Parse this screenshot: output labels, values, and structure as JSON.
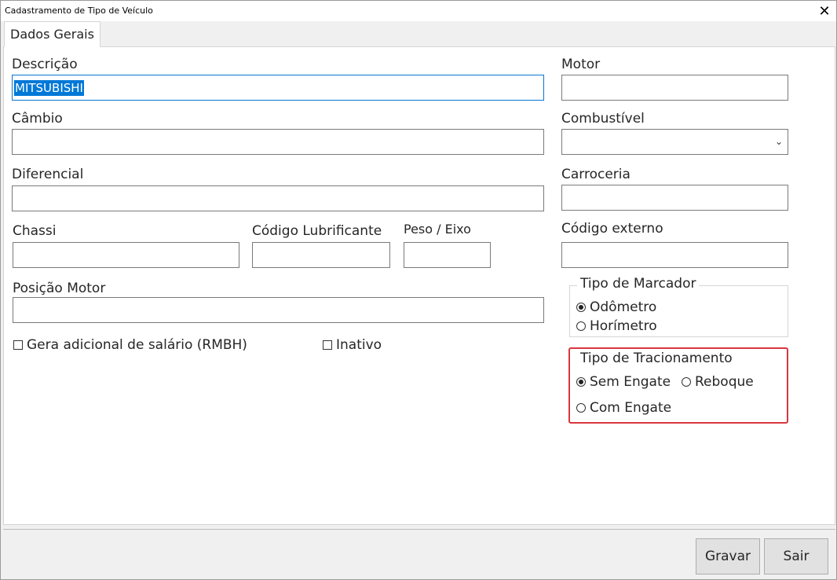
{
  "window": {
    "title": "Cadastramento de Tipo de Veículo",
    "close_glyph": "✕"
  },
  "tabs": [
    {
      "label": "Dados Gerais"
    }
  ],
  "form": {
    "descricao": {
      "label": "Descrição",
      "value": "MITSUBISHI"
    },
    "cambio": {
      "label": "Câmbio",
      "value": ""
    },
    "diferencial": {
      "label": "Diferencial",
      "value": ""
    },
    "chassi": {
      "label": "Chassi",
      "value": ""
    },
    "codigo_lubrificante": {
      "label": "Código Lubrificante",
      "value": ""
    },
    "peso_eixo": {
      "label": "Peso / Eixo",
      "value": ""
    },
    "posicao_motor": {
      "label": "Posição Motor",
      "value": ""
    },
    "motor": {
      "label": "Motor",
      "value": ""
    },
    "combustivel": {
      "label": "Combustível",
      "value": "",
      "arrow": "⌄"
    },
    "carroceria": {
      "label": "Carroceria",
      "value": ""
    },
    "codigo_externo": {
      "label": "Código externo",
      "value": ""
    },
    "gera_adicional": {
      "label": "Gera adicional de salário (RMBH)",
      "checked": false
    },
    "inativo": {
      "label": "Inativo",
      "checked": false
    }
  },
  "tipo_marcador": {
    "legend": "Tipo de Marcador",
    "options": [
      {
        "label": "Odômetro",
        "selected": true
      },
      {
        "label": "Horímetro",
        "selected": false
      }
    ]
  },
  "tipo_tracionamento": {
    "legend": "Tipo de Tracionamento",
    "options": [
      {
        "label": "Sem Engate",
        "selected": true
      },
      {
        "label": "Reboque",
        "selected": false
      },
      {
        "label": "Com Engate",
        "selected": false
      }
    ],
    "highlight_color": "#d9363e"
  },
  "buttons": {
    "gravar": "Gravar",
    "sair": "Sair"
  },
  "colors": {
    "selection": "#0078d7",
    "focus_border": "#0a74d4"
  },
  "icons": {
    "close": "close-icon",
    "dropdown": "chevron-down-icon"
  }
}
